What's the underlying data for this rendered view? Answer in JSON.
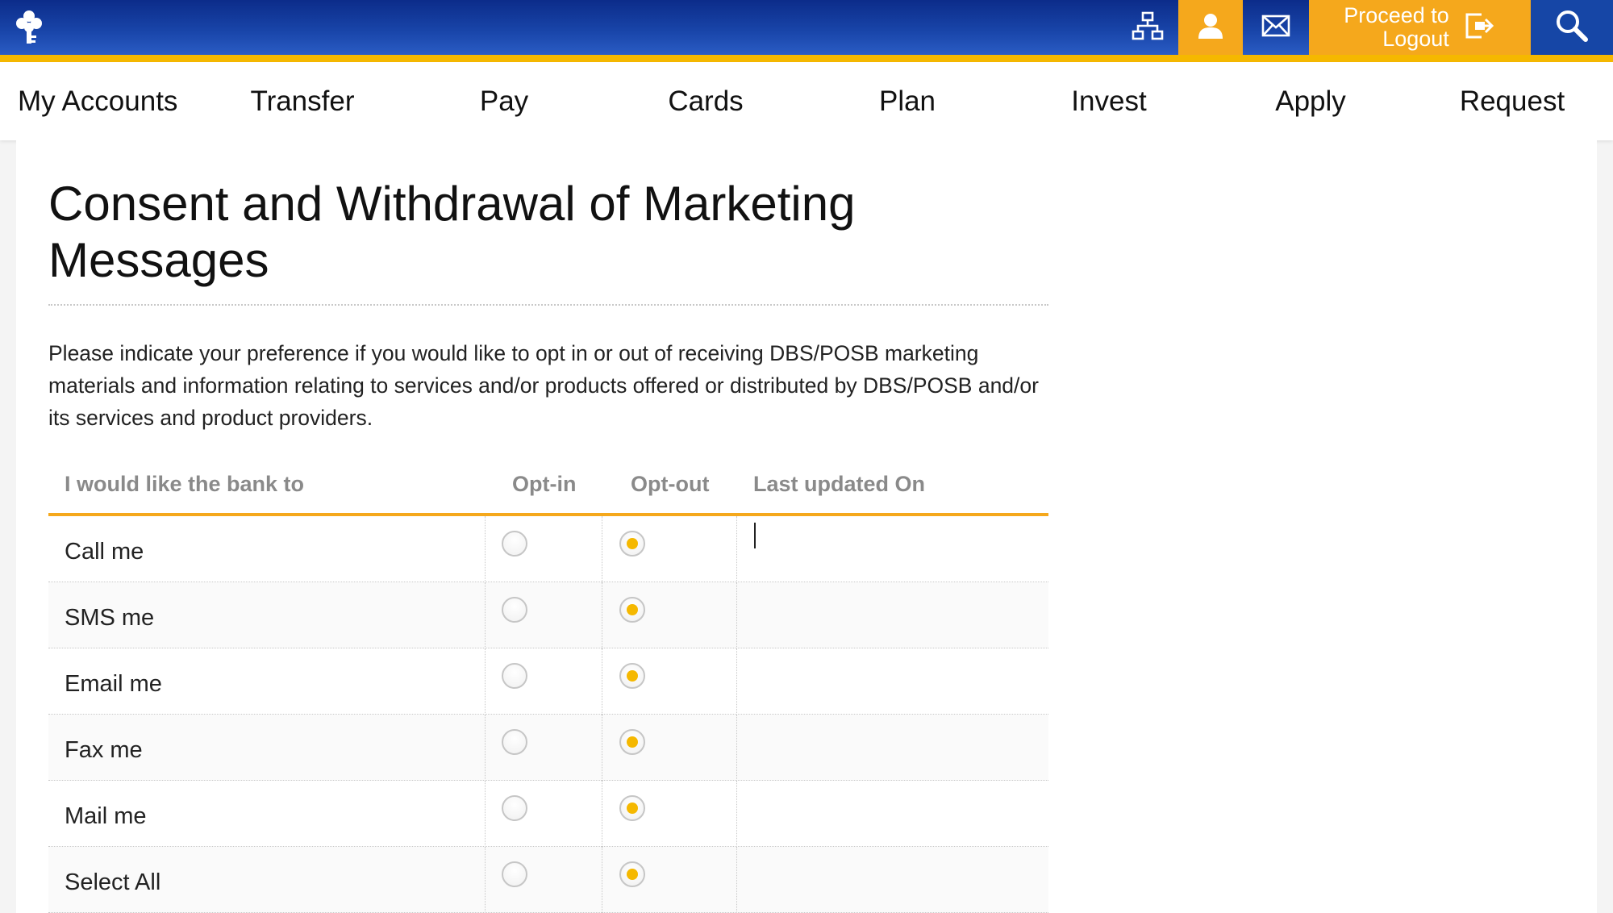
{
  "header": {
    "logout_line1": "Proceed to",
    "logout_line2": "Logout",
    "icons": [
      "dbs-logo-icon",
      "sitemap-icon",
      "profile-icon",
      "mail-icon",
      "logout-icon",
      "search-icon"
    ],
    "colors": {
      "brand_blue": "#1844a8",
      "accent_orange": "#f5a81c",
      "accent_yellow": "#f5b800"
    }
  },
  "nav": {
    "items": [
      "My Accounts",
      "Transfer",
      "Pay",
      "Cards",
      "Plan",
      "Invest",
      "Apply",
      "Request"
    ]
  },
  "page": {
    "title": "Consent and Withdrawal of Marketing Messages",
    "intro": "Please indicate your preference if you would like to opt in or out of receiving DBS/POSB marketing materials and information relating to services and/or products offered or distributed by DBS/POSB and/or its services and product providers."
  },
  "table": {
    "columns": [
      "I would like the bank to",
      "Opt-in",
      "Opt-out",
      "Last updated On"
    ],
    "rows": [
      {
        "label": "Call me",
        "opt_in": false,
        "opt_out": true,
        "last_updated": ""
      },
      {
        "label": "SMS me",
        "opt_in": false,
        "opt_out": true,
        "last_updated": ""
      },
      {
        "label": "Email me",
        "opt_in": false,
        "opt_out": true,
        "last_updated": ""
      },
      {
        "label": "Fax me",
        "opt_in": false,
        "opt_out": true,
        "last_updated": ""
      },
      {
        "label": "Mail me",
        "opt_in": false,
        "opt_out": true,
        "last_updated": ""
      },
      {
        "label": "Select All",
        "opt_in": false,
        "opt_out": true,
        "last_updated": ""
      }
    ]
  }
}
